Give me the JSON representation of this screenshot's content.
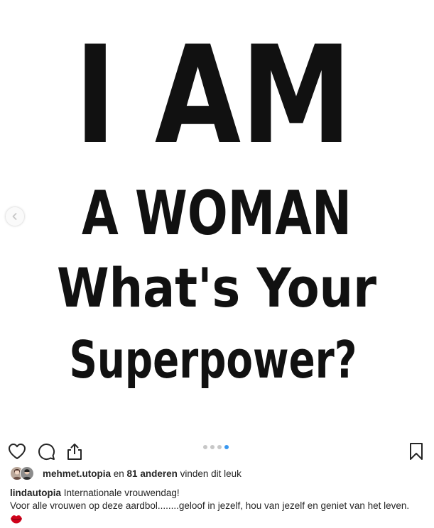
{
  "post": {
    "image_text": {
      "line1": "I AM",
      "line2": "A WOMAN",
      "line3": "What's Your",
      "line4": "Superpower?"
    },
    "carousel": {
      "total": 4,
      "active_index": 4
    }
  },
  "actions": {
    "like_icon": "heart-icon",
    "comment_icon": "comment-icon",
    "share_icon": "share-icon",
    "save_icon": "bookmark-icon",
    "prev_icon": "chevron-left-icon"
  },
  "likes": {
    "user": "mehmet.utopia",
    "connector": " en ",
    "others": "81 anderen",
    "suffix": " vinden dit leuk"
  },
  "caption": {
    "username": "lindautopia",
    "line1": " Internationale vrouwendag!",
    "line2": "Voor alle vrouwen op deze aardbol........geloof in jezelf, hou van jezelf en geniet van het leven.",
    "emoji": "lips-icon"
  },
  "colors": {
    "text": "#262626",
    "dot_active": "#3897f0",
    "dot_inactive": "#c7c7c7",
    "lips": "#d0021b"
  }
}
